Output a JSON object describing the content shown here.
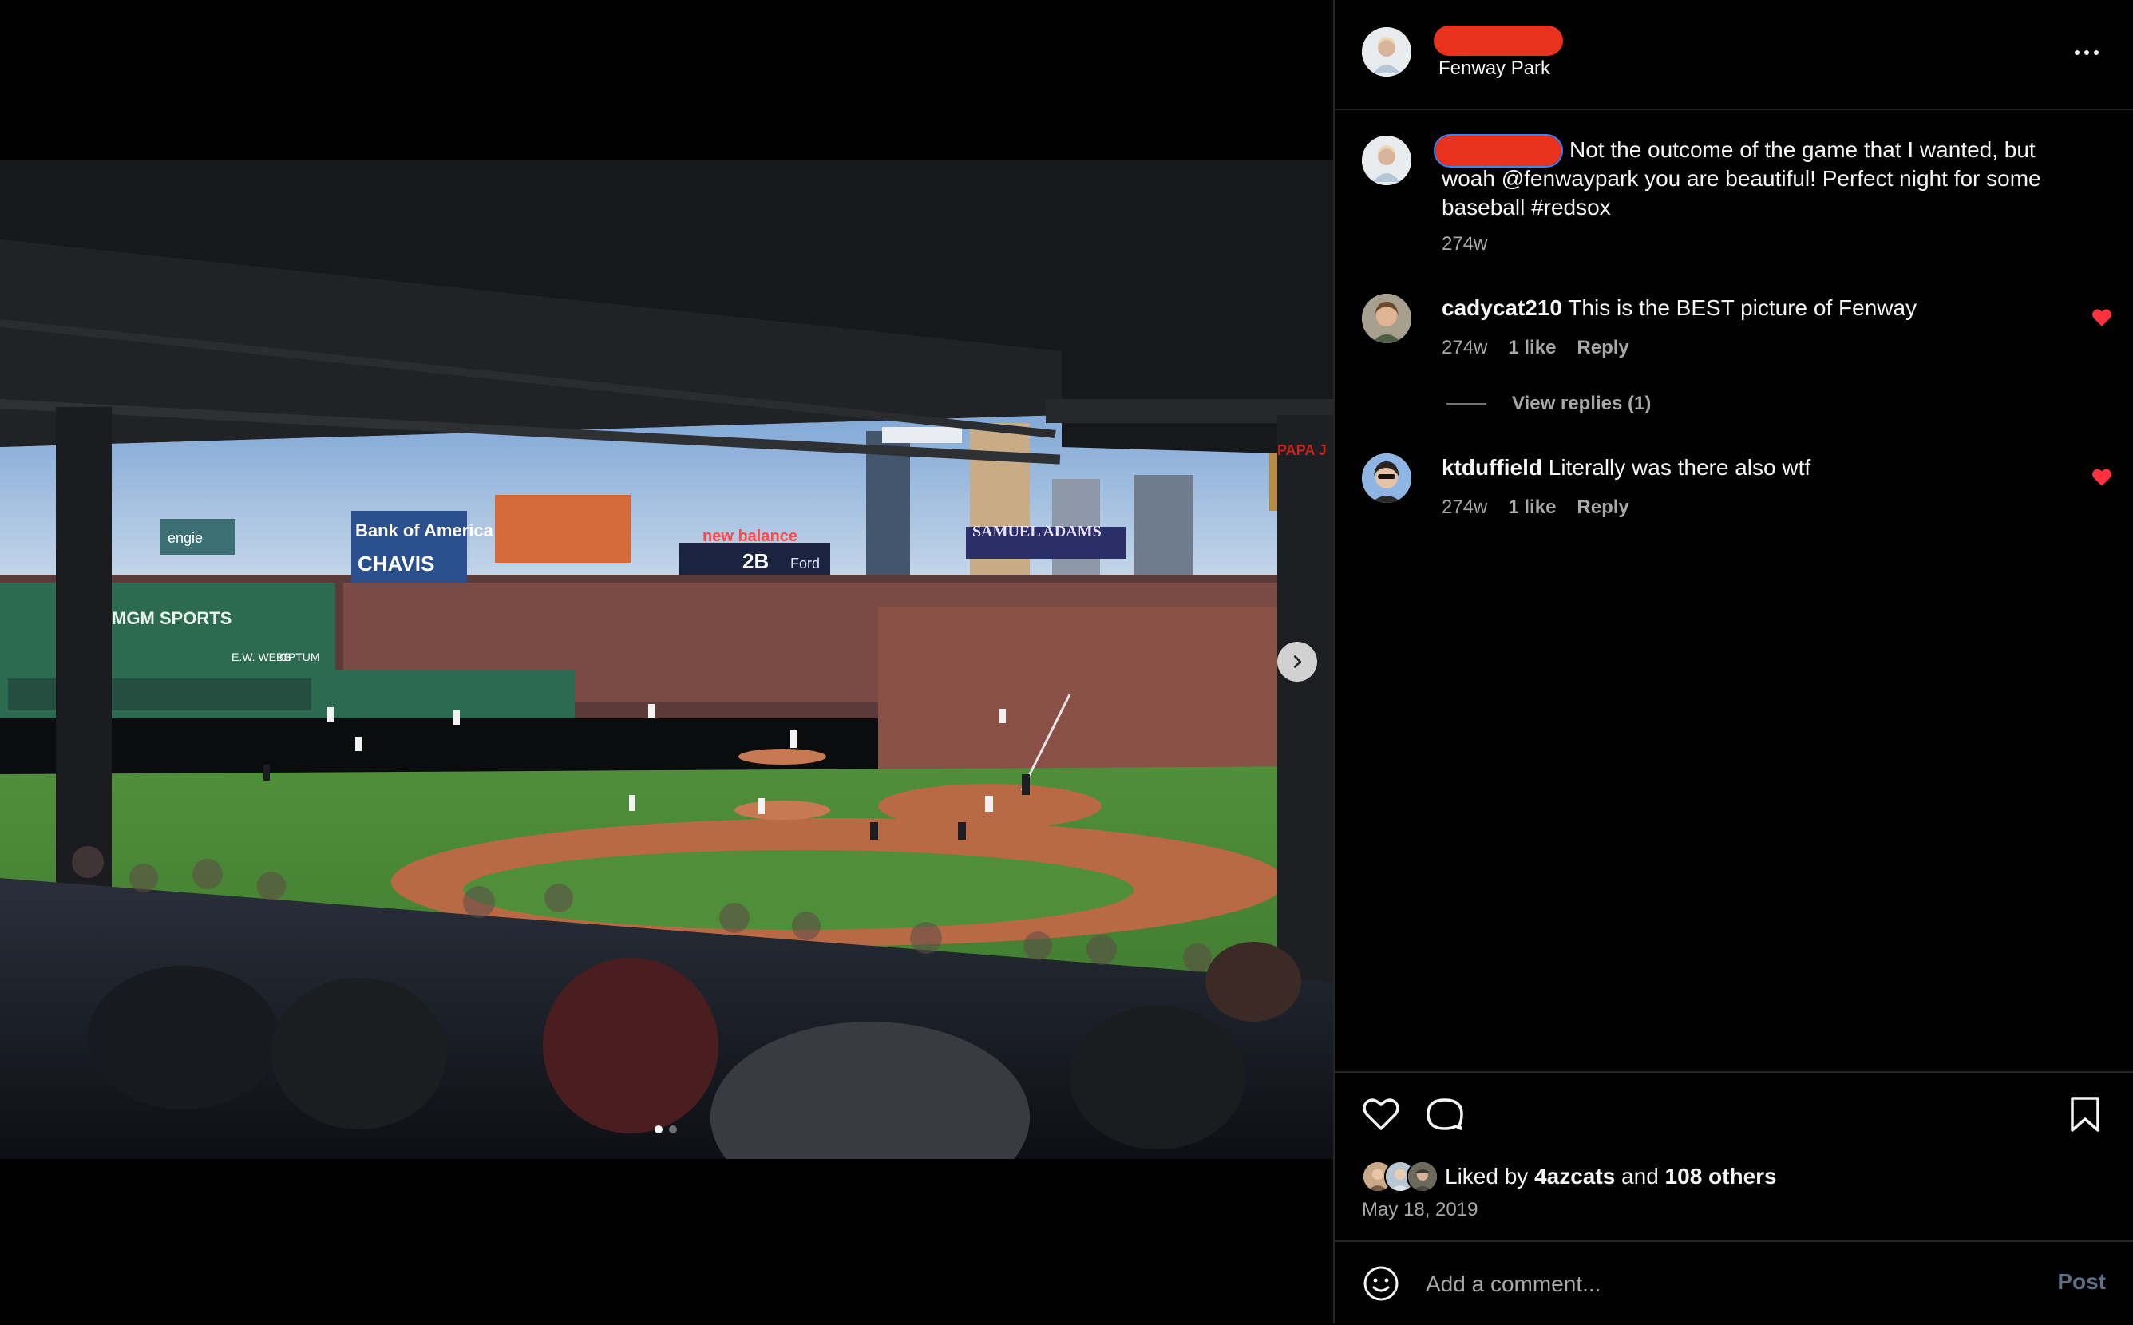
{
  "post": {
    "location": "Fenway Park",
    "caption_text": "Not the outcome of the game that I wanted, but woah @fenwaypark you are beautiful! Perfect night for some baseball #redsox",
    "caption_age": "274w"
  },
  "comments": [
    {
      "username": "cadycat210",
      "text": "This is the BEST picture of Fenway",
      "age": "274w",
      "likes": "1 like",
      "reply_label": "Reply",
      "view_replies": "View replies (1)"
    },
    {
      "username": "ktduffield",
      "text": "Literally was there also wtf",
      "age": "274w",
      "likes": "1 like",
      "reply_label": "Reply"
    }
  ],
  "likes": {
    "prefix": "Liked by",
    "first_user": "4azcats",
    "joiner": "and",
    "others": "108 others"
  },
  "date": "May 18, 2019",
  "add_comment": {
    "placeholder": "Add a comment...",
    "post_label": "Post"
  },
  "carousel": {
    "current_slide": 1,
    "total_slides": 2
  },
  "photo_signage": {
    "bank": "Bank of America",
    "engie": "engie",
    "board_name": "CHAVIS",
    "new_balance": "new balance",
    "inning_box": "2B",
    "ford": "Ford",
    "samuel_adams": "SAMUEL ADAMS",
    "papa": "PAPA J",
    "mgm": "MGM SPORTS",
    "ew_webb": "E.W. WEBB",
    "optum": "OPTUM"
  },
  "colors": {
    "like_red": "#ff3040",
    "redaction": "#e8321e",
    "secondary_text": "#a8a8a8",
    "post_disabled": "#5f6f85"
  },
  "icons": {
    "like": "heart-outline-icon",
    "comment": "comment-bubble-icon",
    "save": "bookmark-icon",
    "emoji": "smiley-icon",
    "more": "ellipsis-icon",
    "next": "chevron-right-icon"
  }
}
